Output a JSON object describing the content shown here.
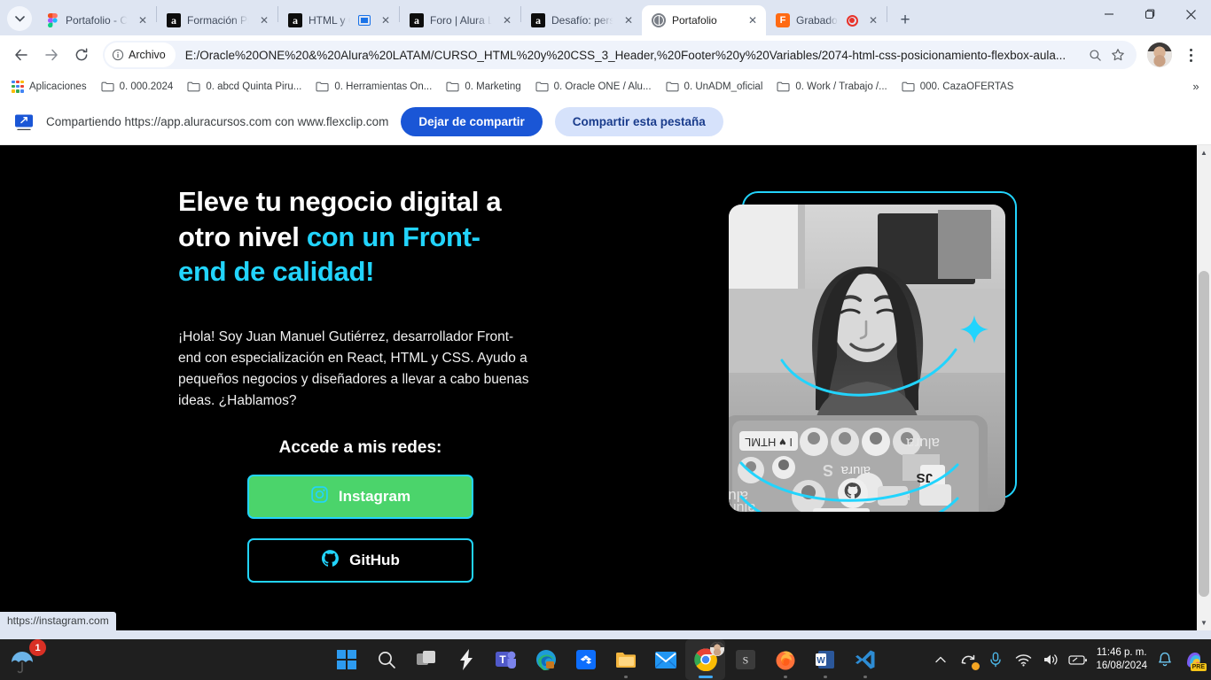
{
  "browser": {
    "tabs": [
      {
        "title": "Portafolio - Curs",
        "favicon": "figma-icon",
        "active": false,
        "has_cast": false
      },
      {
        "title": "Formación Princ",
        "favicon": "alura-icon",
        "active": false,
        "has_cast": false
      },
      {
        "title": "HTML y CSS",
        "favicon": "alura-icon",
        "active": false,
        "has_cast": true
      },
      {
        "title": "Foro | Alura Lata",
        "favicon": "alura-icon",
        "active": false,
        "has_cast": false
      },
      {
        "title": "Desafío: persona",
        "favicon": "alura-icon",
        "active": false,
        "has_cast": false
      },
      {
        "title": "Portafolio",
        "favicon": "globe-icon",
        "active": true,
        "has_cast": false
      },
      {
        "title": "Grabador de",
        "favicon": "flexclip-icon",
        "active": false,
        "has_recording": true
      }
    ],
    "tab_close_label": "✕",
    "new_tab_label": "+",
    "window_controls": {
      "minimize": "—",
      "maximize": "❐",
      "close": "✕"
    },
    "omnibox": {
      "file_chip_label": "Archivo",
      "url": "E:/Oracle%20ONE%20&%20Alura%20LATAM/CURSO_HTML%20y%20CSS_3_Header,%20Footer%20y%20Variables/2074-html-css-posicionamiento-flexbox-aula...",
      "zoom_icon": "search-icon",
      "bookmark_icon": "star-icon"
    },
    "bookmarks": [
      {
        "label": "Aplicaciones",
        "icon": "apps-grid-icon"
      },
      {
        "label": "0. 000.2024",
        "icon": "folder-icon"
      },
      {
        "label": "0. abcd Quinta Piru...",
        "icon": "folder-icon"
      },
      {
        "label": "0. Herramientas On...",
        "icon": "folder-icon"
      },
      {
        "label": "0. Marketing",
        "icon": "folder-icon"
      },
      {
        "label": "0. Oracle ONE / Alu...",
        "icon": "folder-icon"
      },
      {
        "label": "0. UnADM_oficial",
        "icon": "folder-icon"
      },
      {
        "label": "0. Work / Trabajo /...",
        "icon": "folder-icon"
      },
      {
        "label": "000. CazaOFERTAS",
        "icon": "folder-icon"
      }
    ],
    "bookmarks_overflow": "»",
    "infobar": {
      "text": "Compartiendo https://app.aluracursos.com con www.flexclip.com",
      "stop_label": "Dejar de compartir",
      "share_tab_label": "Compartir esta pestaña"
    },
    "status_url": "https://instagram.com"
  },
  "page": {
    "title_line1": "Eleve tu negocio digital a",
    "title_line2_plain": "otro nivel ",
    "title_line2_accent": "con un Front-",
    "title_line3_accent": "end de calidad!",
    "description": "¡Hola! Soy Juan Manuel Gutiérrez, desarrollador Front-end con especialización en React, HTML y CSS. Ayudo a pequeños negocios y diseñadores a llevar a cabo buenas ideas. ¿Hablamos?",
    "redes_heading": "Accede a mis redes:",
    "buttons": [
      {
        "label": "Instagram",
        "icon": "instagram-icon",
        "style": "filled-green"
      },
      {
        "label": "GitHub",
        "icon": "github-icon",
        "style": "outline"
      }
    ],
    "colors": {
      "accent": "#22d4fd",
      "background": "#000000",
      "instagram_button": "#4bd46b",
      "text": "#ffffff"
    },
    "photo_alt": "Mujer sonriendo frente a una laptop con stickers"
  },
  "taskbar": {
    "umbrella_badge": "1",
    "items": [
      {
        "name": "start-button",
        "icon": "windows-icon"
      },
      {
        "name": "search-button",
        "icon": "search-icon"
      },
      {
        "name": "task-view-button",
        "icon": "task-view-icon"
      },
      {
        "name": "shazam-button",
        "icon": "lightning-icon"
      },
      {
        "name": "teams-button",
        "icon": "teams-icon"
      },
      {
        "name": "edge-button",
        "icon": "edge-icon"
      },
      {
        "name": "dropbox-button",
        "icon": "dropbox-icon"
      },
      {
        "name": "explorer-button",
        "icon": "folder-icon"
      },
      {
        "name": "mail-button",
        "icon": "mail-icon"
      },
      {
        "name": "chrome-button",
        "icon": "chrome-icon"
      },
      {
        "name": "sublime-button",
        "icon": "s-icon"
      },
      {
        "name": "firefox-button",
        "icon": "firefox-icon"
      },
      {
        "name": "word-button",
        "icon": "word-icon"
      },
      {
        "name": "vscode-button",
        "icon": "vscode-icon"
      }
    ],
    "tray": {
      "chevron": "⌃",
      "onedrive": "onedrive-icon",
      "mic": "microphone-icon",
      "wifi": "wifi-icon",
      "volume": "speaker-icon",
      "battery": "battery-icon",
      "time": "11:46 p. m.",
      "date": "16/08/2024",
      "notifications": "bell-icon",
      "copilot_badge": "PRE"
    }
  }
}
